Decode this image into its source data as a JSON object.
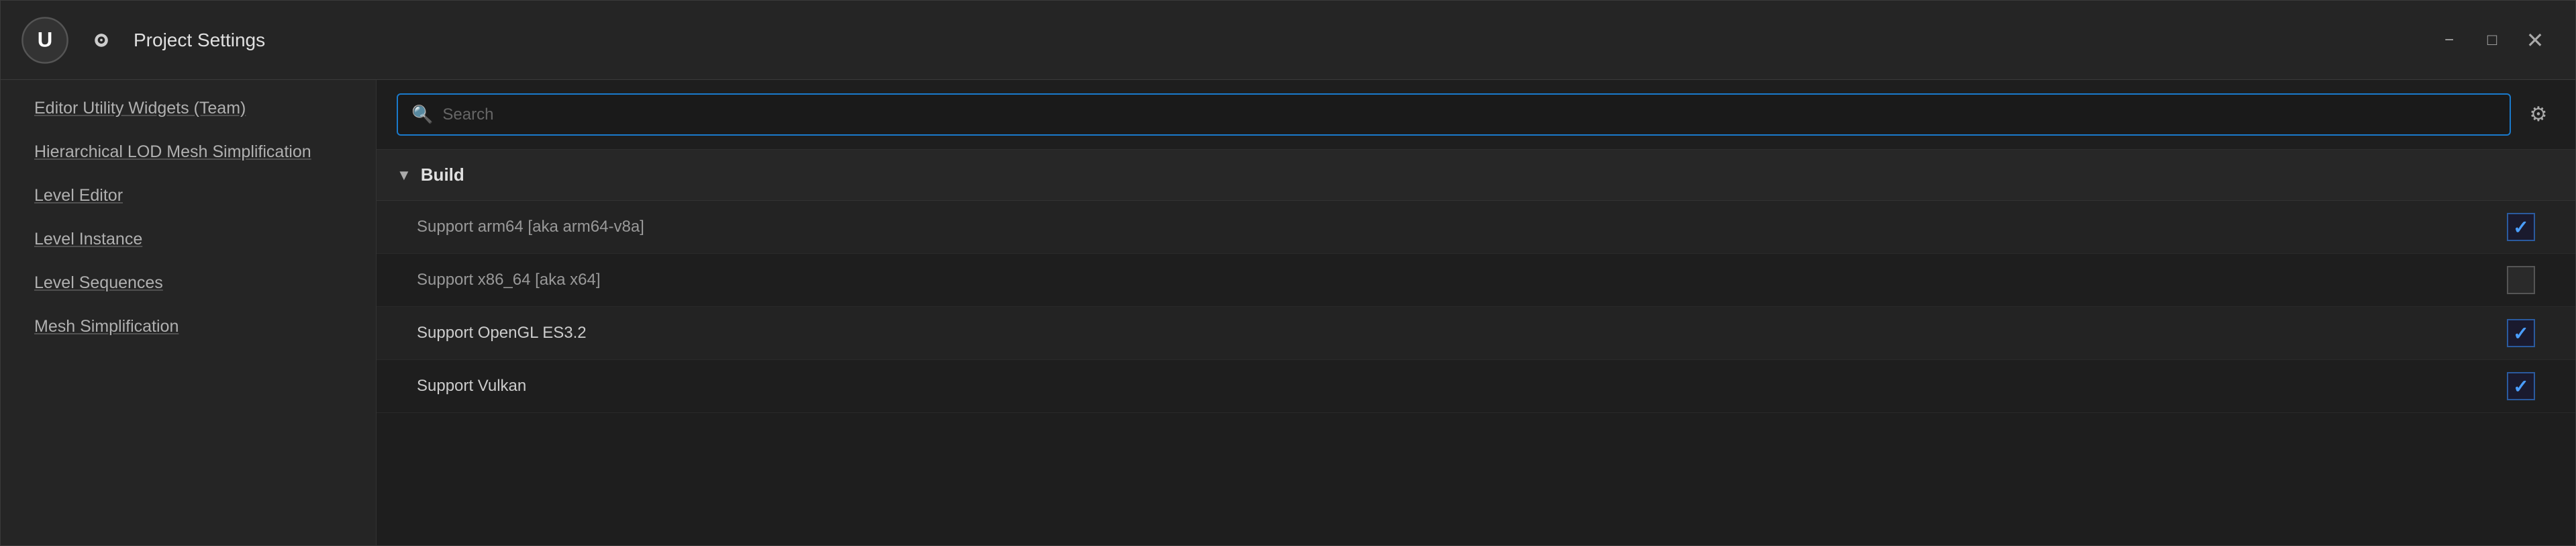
{
  "window": {
    "title": "Project Settings",
    "minimize_label": "−",
    "maximize_label": "□",
    "close_label": "✕"
  },
  "sidebar": {
    "items": [
      {
        "id": "editor-utility-widgets",
        "label": "Editor Utility Widgets (Team)"
      },
      {
        "id": "hierarchical-lod",
        "label": "Hierarchical LOD Mesh Simplification"
      },
      {
        "id": "level-editor",
        "label": "Level Editor"
      },
      {
        "id": "level-instance",
        "label": "Level Instance"
      },
      {
        "id": "level-sequences",
        "label": "Level Sequences"
      },
      {
        "id": "mesh-simplification",
        "label": "Mesh Simplification"
      }
    ]
  },
  "search": {
    "placeholder": "Search",
    "value": ""
  },
  "sections": [
    {
      "id": "build",
      "title": "Build",
      "expanded": true,
      "settings": [
        {
          "id": "support-arm64",
          "label": "Support arm64 [aka arm64-v8a]",
          "checked": true,
          "enabled": false
        },
        {
          "id": "support-x86-64",
          "label": "Support x86_64 [aka x64]",
          "checked": false,
          "enabled": false
        },
        {
          "id": "support-opengl-es32",
          "label": "Support OpenGL ES3.2",
          "checked": true,
          "enabled": true
        },
        {
          "id": "support-vulkan",
          "label": "Support Vulkan",
          "checked": true,
          "enabled": true
        }
      ]
    }
  ],
  "icons": {
    "search": "🔍",
    "settings_gear": "⚙",
    "arrow_down": "▼",
    "checkmark": "✓"
  },
  "colors": {
    "accent_blue": "#1a7acc",
    "check_blue": "#4a9eff",
    "bg_dark": "#1e1e1e",
    "bg_sidebar": "#252525",
    "bg_header": "#272727",
    "text_primary": "#e0e0e0",
    "text_secondary": "#999999"
  }
}
